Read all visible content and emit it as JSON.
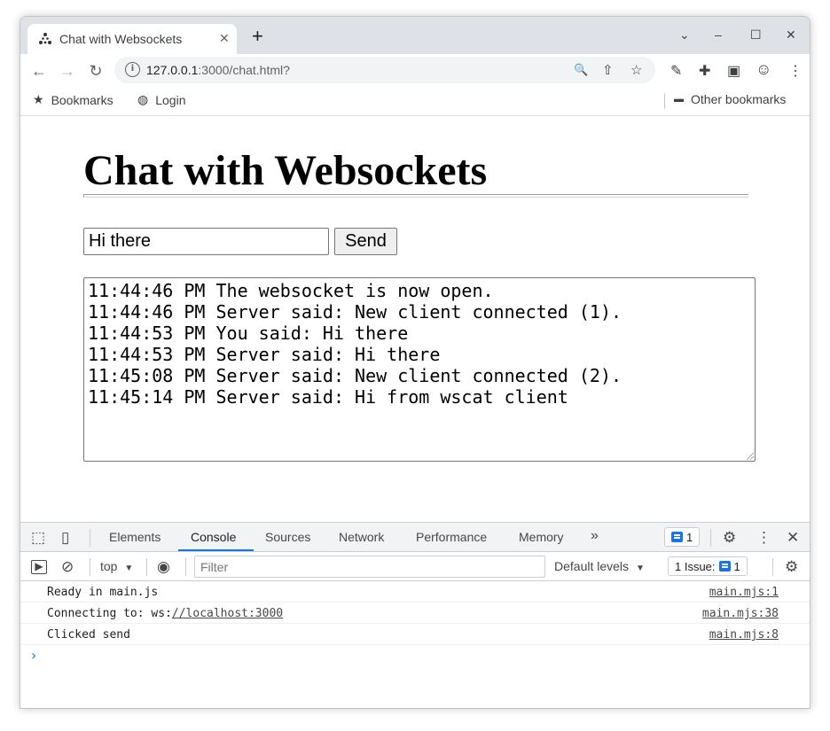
{
  "browser": {
    "tab": {
      "title": "Chat with Websockets",
      "close_glyph": "✕",
      "favicon": "websocket-dots-icon"
    },
    "new_tab_glyph": "+",
    "window_controls": {
      "menu": "⌄",
      "minimize": "–",
      "maximize": "☐",
      "close": "✕"
    },
    "nav": {
      "back": "←",
      "forward": "→",
      "reload": "↻"
    },
    "address": {
      "info_glyph": "i",
      "host": "127.0.0.1",
      "rest": ":3000/chat.html?"
    },
    "omnibox_icons": {
      "zoom": "🔍",
      "share": "⇧",
      "bookmark_star": "☆"
    },
    "toolbar_icons": {
      "eyedropper": "✎",
      "extensions": "✚",
      "side_panel": "▣",
      "profile": "☺",
      "menu": "⋮"
    },
    "bookmarks": {
      "items": [
        {
          "label": "Bookmarks",
          "icon": "★"
        },
        {
          "label": "Login",
          "icon": "◍"
        }
      ],
      "other": {
        "label": "Other bookmarks",
        "icon": "▬"
      }
    }
  },
  "page": {
    "heading": "Chat with Websockets",
    "message_input_value": "Hi there",
    "send_label": "Send",
    "log_lines": [
      "11:44:46 PM The websocket is now open.",
      "11:44:46 PM Server said: New client connected (1).",
      "11:44:53 PM You said: Hi there",
      "11:44:53 PM Server said: Hi there",
      "11:45:08 PM Server said: New client connected (2).",
      "11:45:14 PM Server said: Hi from wscat client"
    ]
  },
  "devtools": {
    "tabs": [
      "Elements",
      "Console",
      "Sources",
      "Network",
      "Performance",
      "Memory"
    ],
    "active_tab": "Console",
    "more_tabs_glyph": "»",
    "messages_badge_count": "1",
    "icons": {
      "inspect": "⬚",
      "device": "▯",
      "settings": "⚙",
      "kebab": "⋮",
      "close": "✕",
      "sidebar": "▶",
      "clear": "⊘",
      "eye": "◉"
    },
    "filter_placeholder": "Filter",
    "context": "top",
    "context_arrow": "▼",
    "levels": "Default levels",
    "levels_arrow": "▼",
    "issues_label": "1 Issue:",
    "issues_count": "1",
    "console_lines": [
      {
        "text": "Ready in main.js",
        "source": "main.mjs:1"
      },
      {
        "text": "Connecting to: ws:",
        "link": "//localhost:3000",
        "source": "main.mjs:38"
      },
      {
        "text": "Clicked send",
        "source": "main.mjs:8"
      }
    ],
    "prompt_glyph": "›"
  }
}
